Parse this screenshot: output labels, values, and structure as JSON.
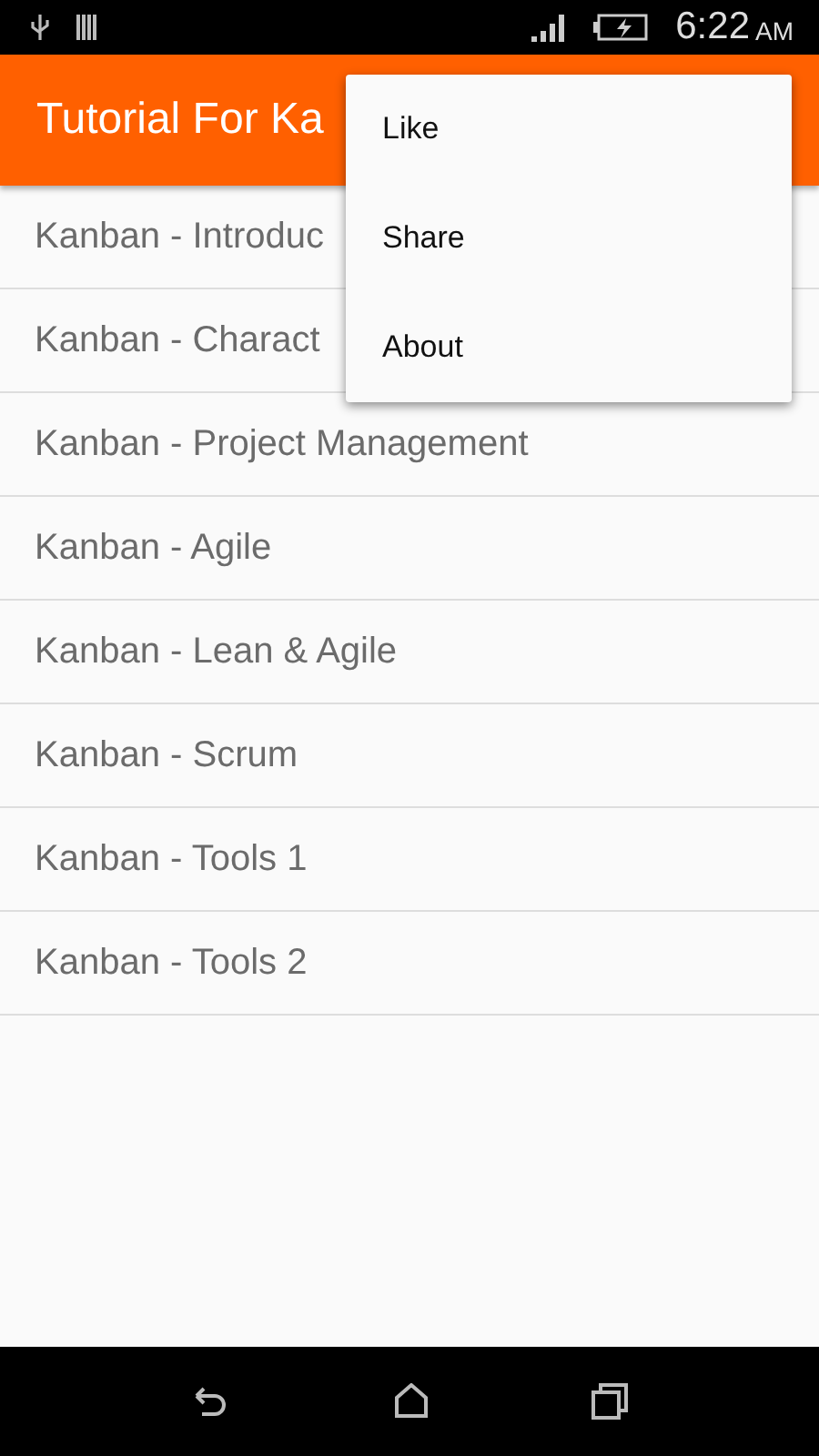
{
  "status_bar": {
    "time": "6:22",
    "meridiem": "AM"
  },
  "app_bar": {
    "title": "Tutorial For Ka"
  },
  "list": [
    {
      "label": "Kanban - Introduc"
    },
    {
      "label": "Kanban - Charact"
    },
    {
      "label": "Kanban - Project Management"
    },
    {
      "label": "Kanban - Agile"
    },
    {
      "label": "Kanban - Lean & Agile"
    },
    {
      "label": "Kanban - Scrum"
    },
    {
      "label": "Kanban - Tools 1"
    },
    {
      "label": "Kanban - Tools 2"
    }
  ],
  "menu": [
    {
      "label": "Like"
    },
    {
      "label": "Share"
    },
    {
      "label": "About"
    }
  ]
}
